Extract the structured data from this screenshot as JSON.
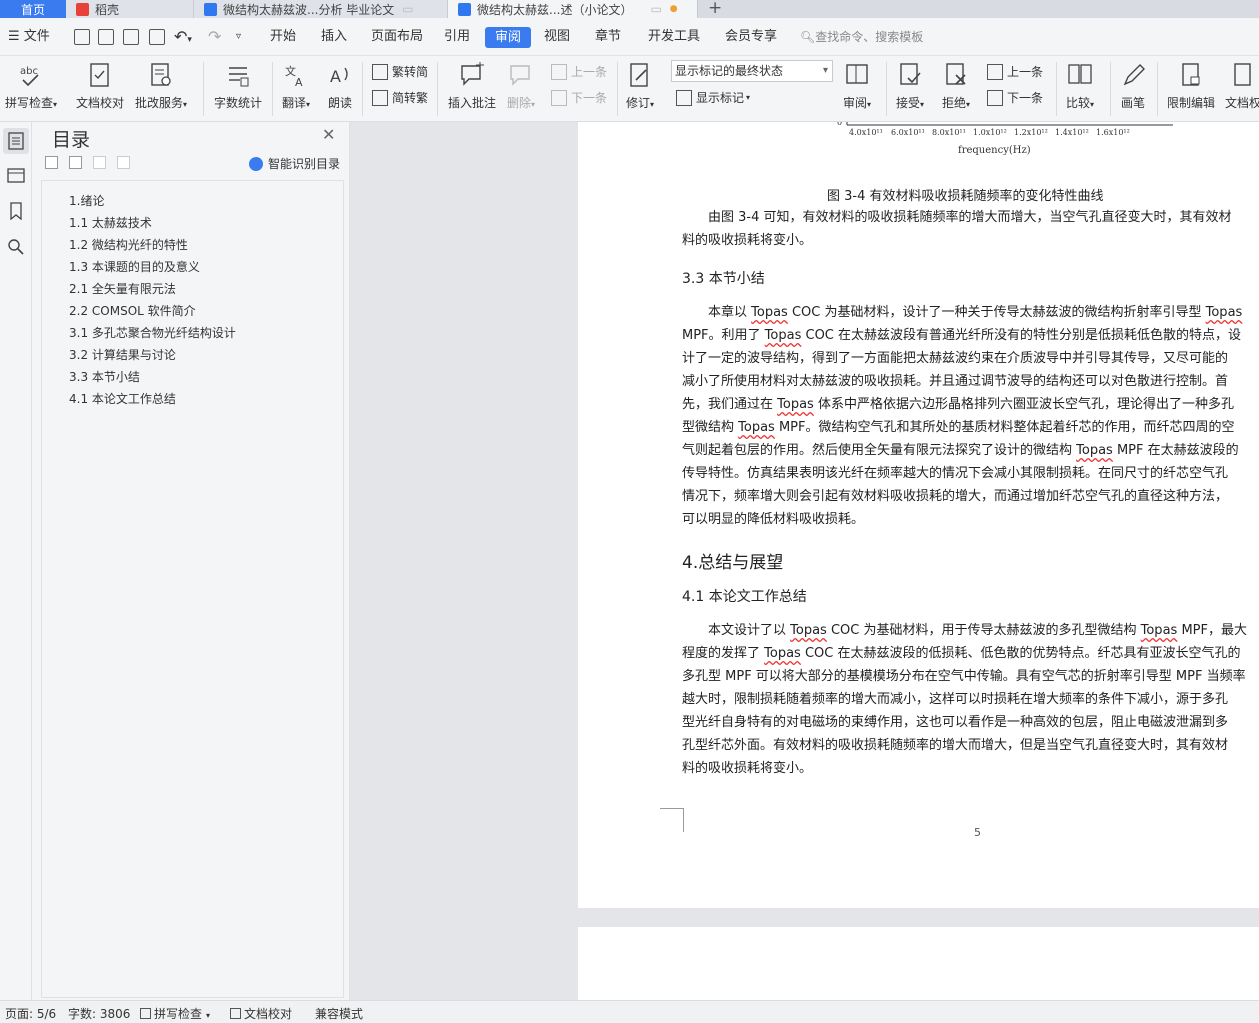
{
  "tabs": {
    "home": "首页",
    "daoke": "稻壳",
    "doc1": "微结构太赫兹波...分析 毕业论文",
    "doc2": "微结构太赫兹...述（小论文）",
    "add": "+"
  },
  "menu": {
    "file": "文件",
    "items": [
      "开始",
      "插入",
      "页面布局",
      "引用",
      "审阅",
      "视图",
      "章节",
      "开发工具",
      "会员专享"
    ],
    "active": "审阅",
    "search_placeholder": "查找命令、搜索模板"
  },
  "ribbon": {
    "spell_check": "拼写检查",
    "doc_proofread": "文档校对",
    "correction_service": "批改服务",
    "word_count": "字数统计",
    "translate": "翻译",
    "read_aloud": "朗读",
    "trad_to_simp": "繁转简",
    "simp_to_trad": "简转繁",
    "insert_comment": "插入批注",
    "delete": "删除",
    "prev_comment": "上一条",
    "next_comment": "下一条",
    "track_changes": "修订",
    "markup_mode": "显示标记的最终状态",
    "show_markup": "显示标记",
    "review": "审阅",
    "accept": "接受",
    "reject": "拒绝",
    "prev_change": "上一条",
    "next_change": "下一条",
    "compare": "比较",
    "ink": "画笔",
    "restrict_edit": "限制编辑",
    "doc_rights": "文档权"
  },
  "toc": {
    "title": "目录",
    "smart_label": "智能识别目录",
    "items": [
      "1.绪论",
      "1.1  太赫兹技术",
      "1.2 微结构光纤的特性",
      "1.3  本课题的目的及意义",
      "2.1    全矢量有限元法",
      "2.2 COMSOL 软件简介",
      "3.1  多孔芯聚合物光纤结构设计",
      "3.2  计算结果与讨论",
      "3.3  本节小结",
      "4.1 本论文工作总结"
    ]
  },
  "doc": {
    "axis_ticks": [
      "4.0x10¹¹",
      "6.0x10¹¹",
      "8.0x10¹¹",
      "1.0x10¹²",
      "1.2x10¹²",
      "1.4x10¹²",
      "1.6x10¹²"
    ],
    "axis_zero": "0",
    "axis_label": "frequency(Hz)",
    "fig_caption": "图 3-4  有效材料吸收损耗随频率的变化特性曲线",
    "para1": [
      "由图 3-4 可知，有效材料的吸收损耗随频率的增大而增大，当空气孔直径变大时，其有效材",
      "料的吸收损耗将变小。"
    ],
    "h_3_3": "3.3  本节小结",
    "para2": [
      "本章以 Topas COC 为基础材料，设计了一种关于传导太赫兹波的微结构折射率引导型 Topas",
      "MPF。利用了 Topas COC 在太赫兹波段有普通光纤所没有的特性分别是低损耗低色散的特点，设",
      "计了一定的波导结构，得到了一方面能把太赫兹波约束在介质波导中并引导其传导，又尽可能的",
      "减小了所使用材料对太赫兹波的吸收损耗。并且通过调节波导的结构还可以对色散进行控制。首",
      "先，我们通过在 Topas 体系中严格依据六边形晶格排列六圈亚波长空气孔，理论得出了一种多孔",
      "型微结构 Topas MPF。微结构空气孔和其所处的基质材料整体起着纤芯的作用，而纤芯四周的空",
      "气则起着包层的作用。然后使用全矢量有限元法探究了设计的微结构 Topas MPF 在太赫兹波段的",
      "传导特性。仿真结果表明该光纤在频率越大的情况下会减小其限制损耗。在同尺寸的纤芯空气孔",
      "情况下，频率增大则会引起有效材料吸收损耗的增大，而通过增加纤芯空气孔的直径这种方法，",
      "可以明显的降低材料吸收损耗。"
    ],
    "h_4": "4.总结与展望",
    "h_4_1": "4.1 本论文工作总结",
    "para3": [
      "本文设计了以 Topas COC 为基础材料，用于传导太赫兹波的多孔型微结构 Topas MPF，最大",
      "程度的发挥了 Topas COC 在太赫兹波段的低损耗、低色散的优势特点。纤芯具有亚波长空气孔的",
      "多孔型 MPF 可以将大部分的基模模场分布在空气中传输。具有空气芯的折射率引导型 MPF 当频率",
      "越大时，限制损耗随着频率的增大而减小，这样可以时损耗在增大频率的条件下减小，源于多孔",
      "型光纤自身特有的对电磁场的束缚作用，这也可以看作是一种高效的包层，阻止电磁波泄漏到多",
      "孔型纤芯外面。有效材料的吸收损耗随频率的增大而增大，但是当空气孔直径变大时，其有效材",
      "料的吸收损耗将变小。"
    ],
    "page_number": "5"
  },
  "status": {
    "page": "页面: 5/6",
    "word_count": "字数: 3806",
    "spell_check": "拼写检查",
    "proofread": "文档校对",
    "compat_mode": "兼容模式"
  },
  "colors": {
    "accent": "#3a7cf0",
    "spell_underline": "#e33"
  }
}
